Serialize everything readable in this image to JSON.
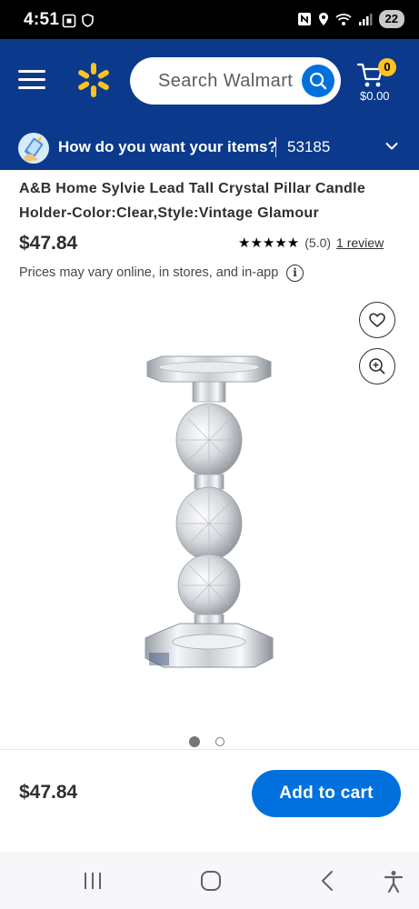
{
  "status_bar": {
    "time": "4:51",
    "battery": "22",
    "icons": [
      "screenshot-icon",
      "shield-icon",
      "nfc-icon",
      "location-icon",
      "wifi-icon",
      "signal-icon"
    ]
  },
  "header": {
    "search_placeholder": "Search Walmart",
    "cart_count": "0",
    "cart_total": "$0.00",
    "brand_color": "#0b3a8c",
    "accent_color": "#0071dc",
    "badge_color": "#ffc220"
  },
  "delivery": {
    "question": "How do you want your items?",
    "zip": "53185"
  },
  "product": {
    "title": "A&B Home Sylvie Lead Tall Crystal Pillar Candle Holder-Color:Clear,Style:Vintage Glamour",
    "price": "$47.84",
    "rating_stars": "★★★★★",
    "rating_value": 5.0,
    "rating_text": "(5.0)",
    "review_link": "1 review",
    "disclaimer": "Prices may vary online, in stores, and in-app",
    "info_symbol": "i"
  },
  "gallery": {
    "image_count": 2,
    "active_index": 0
  },
  "sticky_bar": {
    "price": "$47.84",
    "add_to_cart": "Add to cart"
  },
  "nav_bar": {
    "items": [
      "recent-apps-icon",
      "home-icon",
      "back-icon",
      "accessibility-icon"
    ]
  }
}
